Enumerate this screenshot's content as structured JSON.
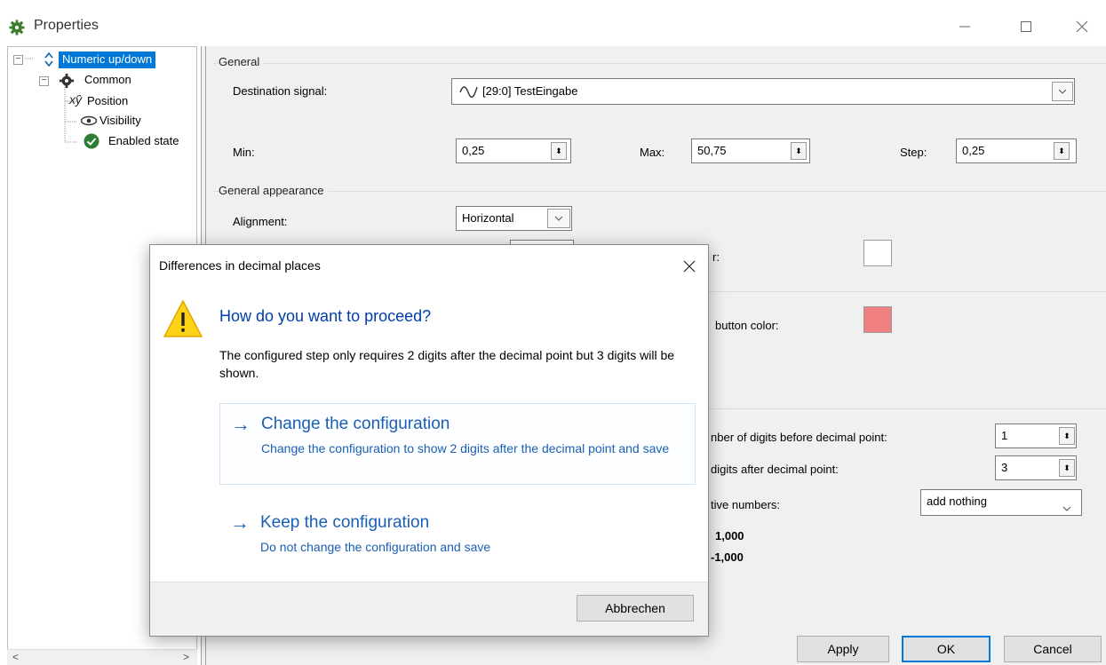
{
  "window": {
    "title": "Properties"
  },
  "tree": {
    "root": "Numeric up/down",
    "common": "Common",
    "children": [
      "Position",
      "Visibility",
      "Enabled state"
    ]
  },
  "general": {
    "title": "General",
    "destination_label": "Destination signal:",
    "destination_value": "[29:0] TestEingabe",
    "min_label": "Min:",
    "min_value": "0,25",
    "max_label": "Max:",
    "max_value": "50,75",
    "step_label": "Step:",
    "step_value": "0,25"
  },
  "appearance": {
    "title": "General appearance",
    "alignment_label": "Alignment:",
    "alignment_value": "Horizontal",
    "color_label_partial": "r:",
    "button_color_label_partial": "button color:",
    "button_color": "#f08080"
  },
  "format": {
    "digits_before_label_partial": "nber of digits before decimal point:",
    "digits_before_value": "1",
    "digits_after_label_partial": "digits after decimal point:",
    "digits_after_value": "3",
    "negative_label_partial": "tive numbers:",
    "negative_value": "add nothing",
    "preview_positive": "1,000",
    "preview_negative": "-1,000"
  },
  "footer": {
    "apply": "Apply",
    "ok": "OK",
    "cancel": "Cancel"
  },
  "dialog": {
    "title": "Differences in decimal places",
    "heading": "How do you want to proceed?",
    "message": "The configured step only requires 2 digits after the decimal point but 3 digits will be shown.",
    "option1_title": "Change the configuration",
    "option1_desc": "Change the configuration to show 2 digits after the decimal point and save",
    "option2_title": "Keep the configuration",
    "option2_desc": "Do not change the configuration and save",
    "cancel": "Abbrechen"
  },
  "colors": {
    "selection": "#0078d7",
    "link": "#1a5fb4",
    "heading": "#003eaa"
  }
}
